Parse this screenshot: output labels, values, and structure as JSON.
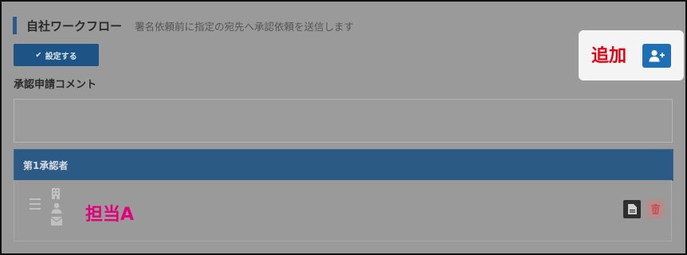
{
  "header": {
    "title": "自社ワークフロー",
    "subtitle": "署名依頼前に指定の宛先へ承認依頼を送信します"
  },
  "settings_button": {
    "check_icon": "✔",
    "label": "設定する"
  },
  "add_card": {
    "label": "追加",
    "button_icon": "add-user-icon"
  },
  "comment": {
    "label": "承認申請コメント",
    "value": ""
  },
  "approver": {
    "title": "第1承認者",
    "assignee": "担当A"
  },
  "colors": {
    "primary": "#1f6fb6",
    "header_bar": "#2b5a84",
    "add_label": "#e60012",
    "assignee": "#e2007d"
  }
}
